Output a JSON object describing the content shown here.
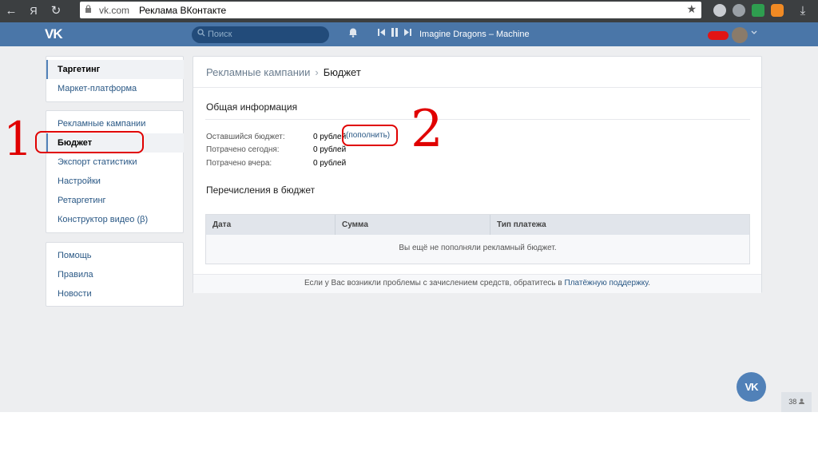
{
  "browser": {
    "back_icon": "←",
    "yandex_label": "Я",
    "reload_icon": "↻",
    "domain": "vk.com",
    "title": "Реклама ВКонтакте",
    "star_icon": "★",
    "download_icon": "⤓"
  },
  "header": {
    "logo": "VK",
    "search_placeholder": "Поиск",
    "track": "Imagine Dragons – Machine"
  },
  "sidebar": {
    "group1": [
      {
        "label": "Таргетинг"
      },
      {
        "label": "Маркет-платформа"
      }
    ],
    "group2": [
      {
        "label": "Рекламные кампании"
      },
      {
        "label": "Бюджет"
      },
      {
        "label": "Экспорт статистики"
      },
      {
        "label": "Настройки"
      },
      {
        "label": "Ретаргетинг"
      },
      {
        "label": "Конструктор видео (β)"
      }
    ],
    "group3": [
      {
        "label": "Помощь"
      },
      {
        "label": "Правила"
      },
      {
        "label": "Новости"
      }
    ]
  },
  "main": {
    "breadcrumb": {
      "parent": "Рекламные кампании",
      "sep": "›",
      "current": "Бюджет"
    },
    "general_title": "Общая информация",
    "rows": [
      {
        "label": "Оставшийся бюджет:",
        "value": "0 рублей"
      },
      {
        "label": "Потрачено сегодня:",
        "value": "0 рублей"
      },
      {
        "label": "Потрачено вчера:",
        "value": "0 рублей"
      }
    ],
    "refill_link": "(пополнить)",
    "transfers_title": "Перечисления в бюджет",
    "table": {
      "columns": [
        "Дата",
        "Сумма",
        "Тип платежа"
      ],
      "empty_text": "Вы ещё не пополняли рекламный бюджет."
    },
    "footer_text": "Если у Вас возникли проблемы с зачислением средств, обратитесь в ",
    "footer_link": "Платёжную поддержку",
    "footer_end": "."
  },
  "annotations": {
    "one": "1",
    "two": "2"
  },
  "fab": {
    "label": "VK"
  },
  "online": {
    "count": "38"
  },
  "colors": {
    "vk_blue": "#4a76a8",
    "link": "#2a5885",
    "annotation_red": "#e00000"
  }
}
